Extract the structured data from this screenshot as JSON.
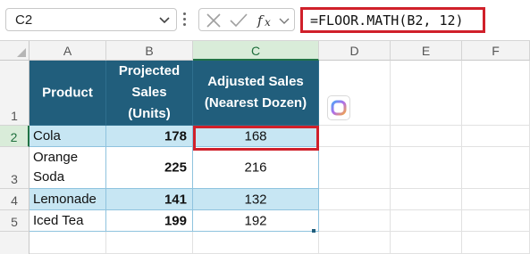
{
  "formula_bar": {
    "name_box": "C2",
    "formula": "=FLOOR.MATH(B2, 12)"
  },
  "columns": [
    "A",
    "B",
    "C",
    "D",
    "E",
    "F"
  ],
  "rows": [
    "1",
    "2",
    "3",
    "4",
    "5"
  ],
  "table": {
    "headers": {
      "product": "Product",
      "projected_line1": "Projected",
      "projected_line2": "Sales",
      "projected_line3": "(Units)",
      "adjusted_line1": "Adjusted Sales",
      "adjusted_line2": "(Nearest Dozen)"
    },
    "rows": [
      {
        "product": "Cola",
        "projected": "178",
        "adjusted": "168"
      },
      {
        "product_line1": "Orange",
        "product_line2": "Soda",
        "projected": "225",
        "adjusted": "216"
      },
      {
        "product": "Lemonade",
        "projected": "141",
        "adjusted": "132"
      },
      {
        "product": "Iced Tea",
        "projected": "199",
        "adjusted": "192"
      }
    ]
  },
  "colors": {
    "header_fill": "#215e7c",
    "band_fill": "#c7e6f3",
    "selection_highlight": "#d0202a",
    "excel_green": "#217346"
  },
  "icons": {
    "name_box_dropdown": "chevron-down-icon",
    "more": "vertical-dots-icon",
    "cancel": "x-icon",
    "enter": "check-icon",
    "insert_function": "fx-icon",
    "copilot": "copilot-icon"
  }
}
